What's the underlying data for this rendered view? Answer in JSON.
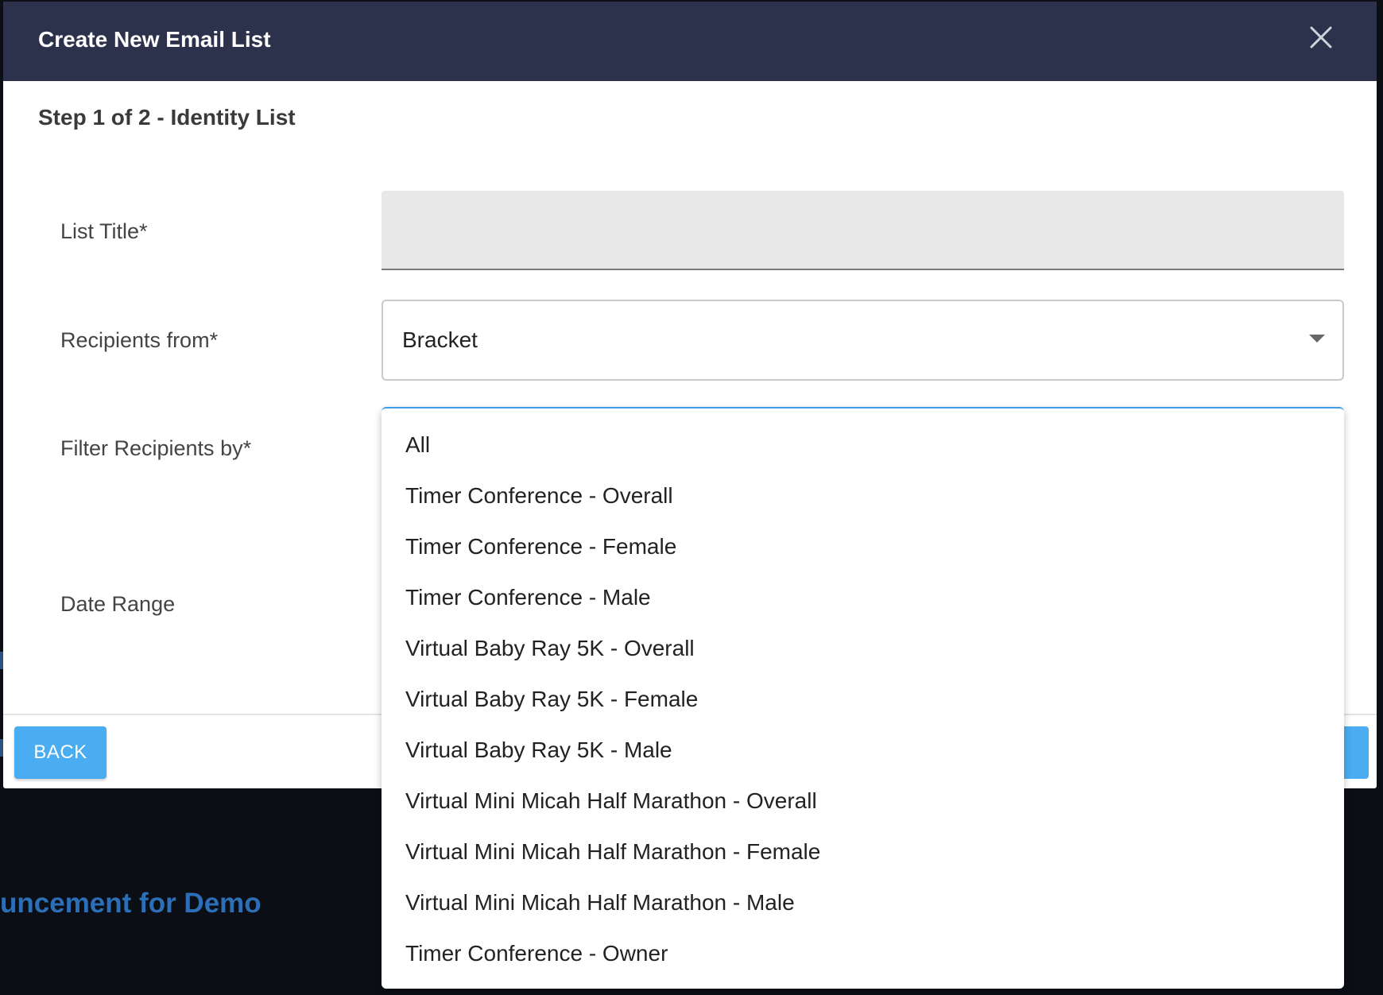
{
  "modal": {
    "title": "Create New Email List",
    "step_title": "Step 1 of 2 - Identity List"
  },
  "form": {
    "list_title_label": "List Title*",
    "list_title_value": "",
    "recipients_label": "Recipients from*",
    "recipients_value": "Bracket",
    "filter_label": "Filter Recipients by*",
    "date_range_label": "Date Range"
  },
  "dropdown": {
    "options": [
      "All",
      "Timer Conference - Overall",
      "Timer Conference - Female",
      "Timer Conference - Male",
      "Virtual Baby Ray 5K - Overall",
      "Virtual Baby Ray 5K - Female",
      "Virtual Baby Ray 5K - Male",
      "Virtual Mini Micah Half Marathon - Overall",
      "Virtual Mini Micah Half Marathon - Female",
      "Virtual Mini Micah Half Marathon - Male",
      "Timer Conference - Owner"
    ]
  },
  "footer": {
    "back_label": "BACK"
  },
  "background": {
    "announcement_text": "uncement for Demo"
  },
  "colors": {
    "header_bg": "#2c324c",
    "primary_button": "#4aadf2",
    "focus_border": "#3d9de8",
    "background_link": "#2d6fb6"
  },
  "icons": {
    "close": "close-icon",
    "select_caret": "chevron-down-icon"
  }
}
